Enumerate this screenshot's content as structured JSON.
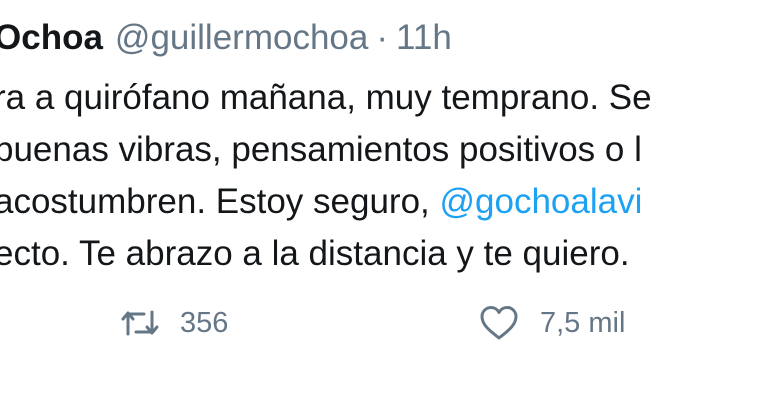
{
  "tweet": {
    "display_name": "Ochoa",
    "handle": "@guillermochoa",
    "separator": "·",
    "time": "11h",
    "lines": [
      {
        "text": "ra a quirófano mañana, muy temprano. Se",
        "mention": ""
      },
      {
        "text": "buenas vibras, pensamientos positivos o l",
        "mention": ""
      },
      {
        "text": "acostumbren. Estoy seguro, ",
        "mention": "@gochoalavi"
      },
      {
        "text": "ecto. Te abrazo a la distancia y te quiero.",
        "mention": ""
      }
    ],
    "actions": {
      "retweet": {
        "icon": "retweet-icon",
        "count": "356"
      },
      "like": {
        "icon": "heart-icon",
        "count": "7,5 mil"
      }
    }
  },
  "colors": {
    "text": "#14171a",
    "secondary": "#657786",
    "link": "#1da1f2"
  }
}
